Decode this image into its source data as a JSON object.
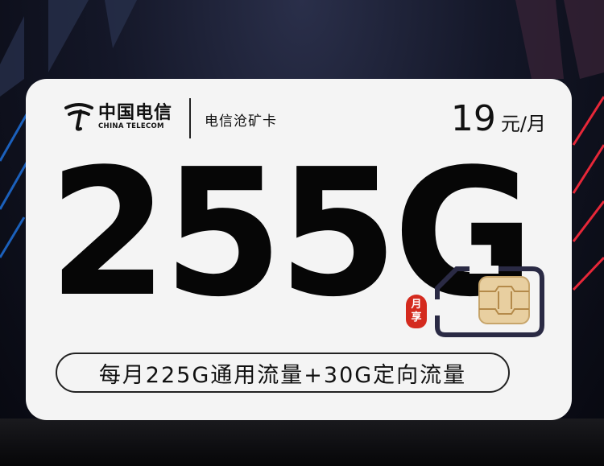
{
  "brand": {
    "name_cn": "中国电信",
    "name_en": "CHINA TELECOM",
    "logo_icon": "china-telecom-logo-icon"
  },
  "plan": {
    "name": "电信沧矿卡",
    "price_value": "19",
    "price_unit": "元/月",
    "data_amount": "255G",
    "badge_line1": "月",
    "badge_line2": "享",
    "description": "每月225G通用流量+30G定向流量"
  },
  "colors": {
    "badge_red": "#d42a1e",
    "card_bg": "#f4f4f4",
    "text_dark": "#060606",
    "accent_blue": "#2a9bff",
    "accent_red": "#ff2a3c"
  }
}
